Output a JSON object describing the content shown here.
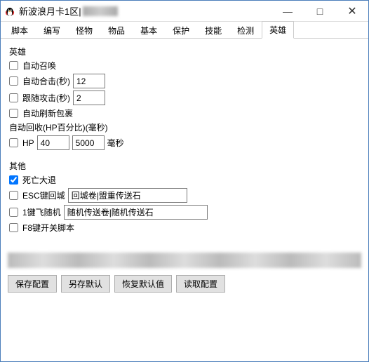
{
  "window": {
    "title": "新波浪月卡1区|",
    "minimize": "—",
    "maximize": "□",
    "close": "✕"
  },
  "tabs": [
    {
      "label": "脚本"
    },
    {
      "label": "编写"
    },
    {
      "label": "怪物"
    },
    {
      "label": "物品"
    },
    {
      "label": "基本"
    },
    {
      "label": "保护"
    },
    {
      "label": "技能"
    },
    {
      "label": "检测"
    },
    {
      "label": "英雄",
      "active": true
    }
  ],
  "hero": {
    "group": "英雄",
    "auto_summon": {
      "label": "自动召唤",
      "checked": false
    },
    "auto_combine": {
      "label": "自动合击(秒)",
      "checked": false,
      "value": "12"
    },
    "follow_attack": {
      "label": "跟随攻击(秒)",
      "checked": false,
      "value": "2"
    },
    "auto_refresh_bag": {
      "label": "自动刷新包裹",
      "checked": false
    },
    "auto_recover_label": "自动回收(HP百分比)(毫秒)",
    "hp": {
      "label": "HP",
      "checked": false,
      "pct": "40",
      "ms": "5000",
      "unit": "毫秒"
    }
  },
  "other": {
    "group": "其他",
    "death_exit": {
      "label": "死亡大退",
      "checked": true
    },
    "esc_return": {
      "label": "ESC键回城",
      "checked": false,
      "value": "回城卷|盟重传送石"
    },
    "one_fly": {
      "label": "1键飞随机",
      "checked": false,
      "value": "随机传送卷|随机传送石"
    },
    "f8_toggle": {
      "label": "F8键开关脚本",
      "checked": false
    }
  },
  "buttons": {
    "save": "保存配置",
    "save_default": "另存默认",
    "restore_default": "恢复默认值",
    "load": "读取配置"
  }
}
